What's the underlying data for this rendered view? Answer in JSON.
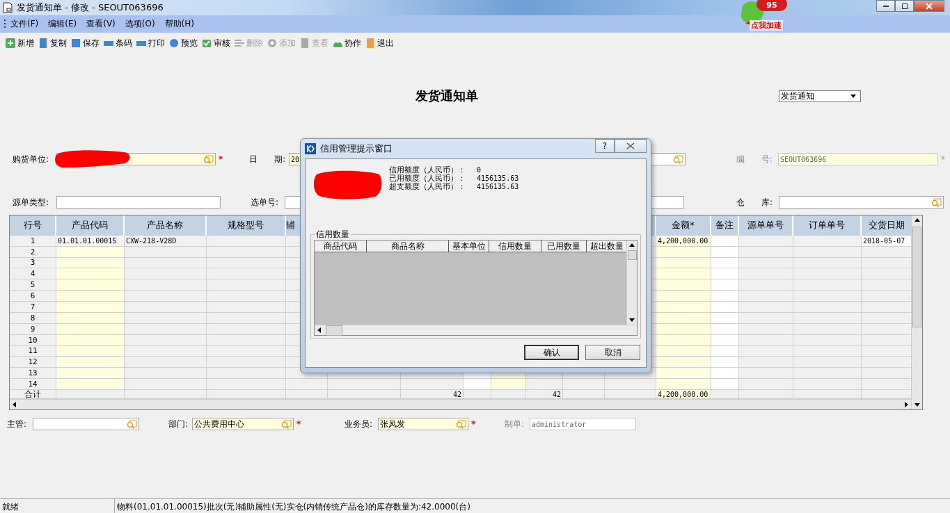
{
  "window": {
    "title": "发货通知单 - 修改 - SEOUT063696"
  },
  "desktop_widget": {
    "score": "95",
    "label": "点我加速"
  },
  "menu": [
    "文件(F)",
    "编辑(E)",
    "查看(V)",
    "选项(O)",
    "帮助(H)"
  ],
  "toolbar": [
    {
      "label": "新增",
      "disabled": false
    },
    {
      "label": "复制",
      "disabled": false
    },
    {
      "label": "保存",
      "disabled": false
    },
    {
      "label": "条码",
      "disabled": false
    },
    {
      "label": "打印",
      "disabled": false
    },
    {
      "label": "预览",
      "disabled": false
    },
    {
      "label": "审核",
      "disabled": false
    },
    {
      "label": "删除",
      "disabled": true
    },
    {
      "label": "添加",
      "disabled": true
    },
    {
      "label": "查看",
      "disabled": true
    },
    {
      "label": "协作",
      "disabled": false
    },
    {
      "label": "退出",
      "disabled": false
    }
  ],
  "form": {
    "title": "发货通知单",
    "type_select": "发货通知",
    "header_rows": [
      [
        {
          "label": "购货单位:",
          "required_mark": "*",
          "lookup": true,
          "highlighted": true,
          "disabled": false,
          "redacted": true
        },
        {
          "label": "日　　期:",
          "value": "20",
          "highlighted": true,
          "disabled": false
        },
        {
          "lookup": true,
          "highlighted": false,
          "disabled": false
        },
        {
          "label": "编　　号:",
          "value": "SEOUT063696",
          "required_mark": "*",
          "lookup": false,
          "highlighted": true,
          "disabled": true,
          "redacted": false
        }
      ],
      [
        {
          "label": "源单类型:",
          "lookup": false,
          "highlighted": false,
          "disabled": false,
          "redacted": false
        },
        {
          "label": "选单号:",
          "highlighted": false,
          "disabled": false
        },
        {
          "lookup": false,
          "highlighted": false,
          "disabled": false
        },
        {
          "label": "仓　　库:",
          "lookup": true,
          "highlighted": false,
          "disabled": false,
          "redacted": false
        }
      ]
    ],
    "footer_fields": [
      {
        "label": "主管:",
        "lookup": true,
        "highlighted": false,
        "disabled": false
      },
      {
        "label": "部门:",
        "value": "公共费用中心",
        "required_mark": "*",
        "lookup": true,
        "highlighted": true,
        "disabled": false
      },
      {
        "label": "业务员:",
        "value": "张凤发",
        "required_mark": "*",
        "lookup": true,
        "highlighted": true,
        "disabled": false
      },
      {
        "label": "制单:",
        "value": "administrator",
        "lookup": false,
        "highlighted": false,
        "disabled": true
      }
    ]
  },
  "table": {
    "columns": [
      "行号",
      "产品代码",
      "产品名称",
      "规格型号",
      "辅",
      "金额*",
      "备注",
      "源单单号",
      "订单单号",
      "交货日期"
    ],
    "rows": [
      [
        "1",
        "01.01.01.00015",
        "CXW-218-V28D",
        "",
        "",
        "4,200,000.00",
        "",
        "",
        "",
        "2018-05-07"
      ],
      [
        "2"
      ],
      [
        "3"
      ],
      [
        "4"
      ],
      [
        "5"
      ],
      [
        "6"
      ],
      [
        "7"
      ],
      [
        "8"
      ],
      [
        "9"
      ],
      [
        "10"
      ],
      [
        "11"
      ],
      [
        "12"
      ],
      [
        "13"
      ],
      [
        "14"
      ]
    ],
    "totals": {
      "label": "合计",
      "column_7": "42",
      "column_10": "42",
      "amount": "4,200,000.00"
    }
  },
  "dialog": {
    "title": "信用管理提示窗口",
    "help_button": "?",
    "lines": [
      {
        "label": "信用额度（人民币）：",
        "value": "0"
      },
      {
        "label": "已用额度（人民币）：",
        "value": "4156135.63"
      },
      {
        "label": "超支额度（人民币）：",
        "value": "4156135.63"
      }
    ],
    "group_title": "信用数量",
    "columns": [
      "商品代码",
      "商品名称",
      "基本单位",
      "信用数量",
      "已用数量",
      "超出数量"
    ],
    "buttons": [
      "确认",
      "取消"
    ]
  },
  "status_bar": [
    "就绪",
    "物料(01.01.01.00015)批次(无)辅助属性(无)实仓(内销传统产品仓)的库存数量为:42.0000(台)"
  ]
}
